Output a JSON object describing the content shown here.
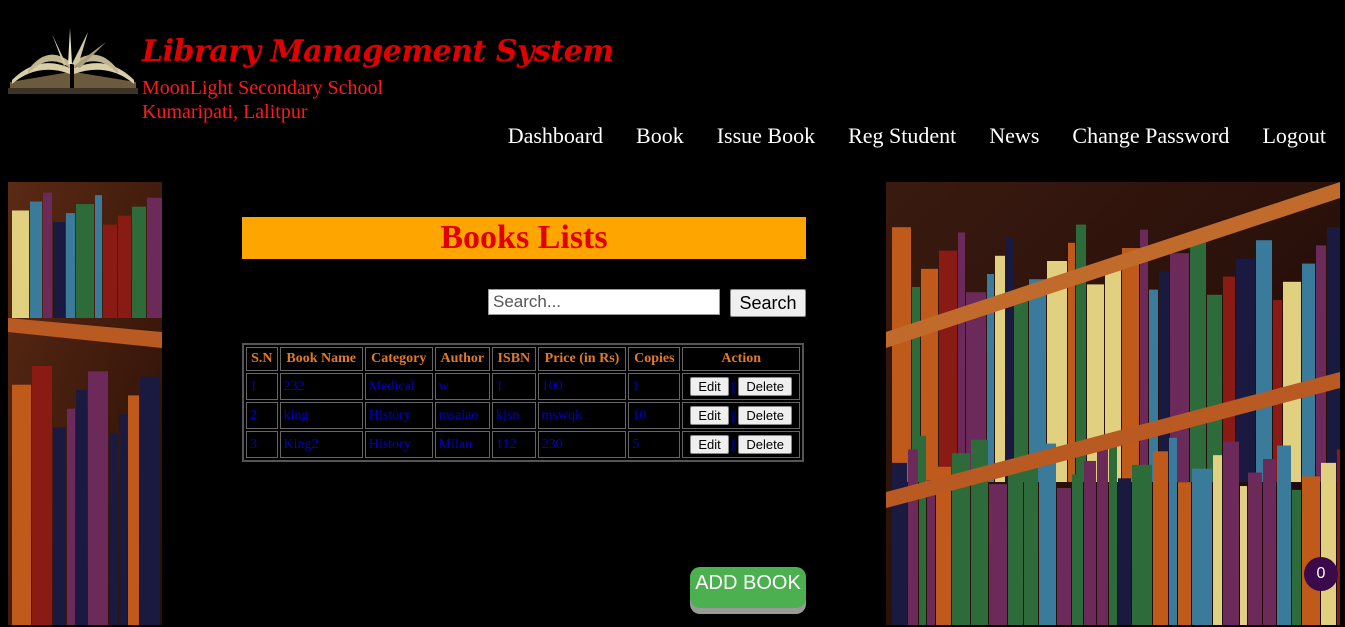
{
  "header": {
    "title": "Library Management System",
    "school_name": "MoonLight Secondary School",
    "school_address": "Kumaripati, Lalitpur",
    "logo_icon": "open-book-icon"
  },
  "nav": [
    {
      "label": "Dashboard"
    },
    {
      "label": "Book"
    },
    {
      "label": "Issue Book"
    },
    {
      "label": "Reg Student"
    },
    {
      "label": "News"
    },
    {
      "label": "Change Password"
    },
    {
      "label": "Logout"
    }
  ],
  "main": {
    "heading": "Books Lists",
    "search": {
      "placeholder": "Search...",
      "value": "",
      "button_label": "Search"
    },
    "table": {
      "columns": [
        "S.N",
        "Book Name",
        "Category",
        "Author",
        "ISBN",
        "Price (in Rs)",
        "Copies",
        "Action"
      ],
      "rows": [
        [
          "1",
          "232",
          "Medical",
          "w",
          "1",
          "100",
          "1"
        ],
        [
          "2",
          "king",
          "History",
          "msaiao",
          "kjsn",
          "mswqk",
          "10"
        ],
        [
          "3",
          "King2",
          "History",
          "Milan",
          "112",
          "230",
          "5"
        ]
      ],
      "edit_label": "Edit",
      "delete_label": "Delete",
      "separator": "||"
    },
    "add_button_label": "ADD BOOK"
  },
  "badge": {
    "count": "0"
  },
  "colors": {
    "title_red": "#e00000",
    "heading_bar": "#ffa500",
    "table_header_text": "#e07a2a",
    "table_cell_text": "#0000cc",
    "add_button": "#4caf50"
  }
}
